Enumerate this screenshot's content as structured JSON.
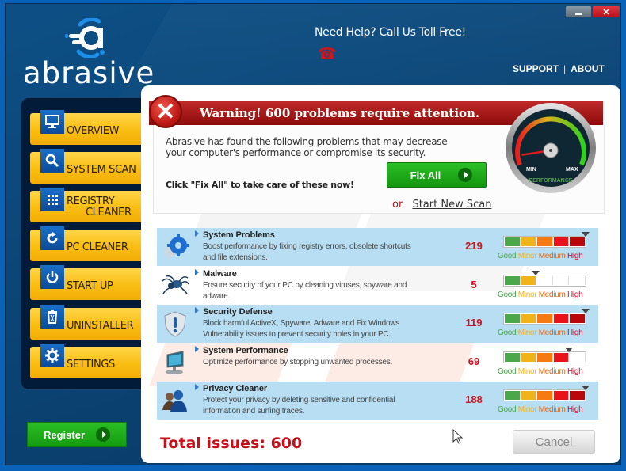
{
  "window": {
    "minimize_label": "_",
    "close_label": "✕"
  },
  "brand": {
    "name": "abrasive",
    "logo_icon": "abrasive-logo-icon"
  },
  "header": {
    "help_text": "Need Help? Call Us Toll Free!",
    "phone_icon": "☎",
    "links": [
      "SUPPORT",
      "ABOUT"
    ],
    "link_separator": "|"
  },
  "sidebar": {
    "items": [
      {
        "label": "OVERVIEW",
        "icon": "monitor-icon"
      },
      {
        "label": "SYSTEM SCAN",
        "icon": "magnifier-icon"
      },
      {
        "label": "REGISTRY",
        "label2": "CLEANER",
        "icon": "grid-icon"
      },
      {
        "label": "PC CLEANER",
        "icon": "refresh-icon"
      },
      {
        "label": "START UP",
        "icon": "power-icon"
      },
      {
        "label": "UNINSTALLER",
        "icon": "trash-icon"
      },
      {
        "label": "SETTINGS",
        "icon": "gear-icon"
      }
    ],
    "register_label": "Register"
  },
  "warning": {
    "title": "Warning! 600 problems require attention.",
    "description": "Abrasive has found the following problems that may decrease your computer's performance or compromise its security.",
    "cta_text": "Click \"Fix All\" to take care of these now!",
    "fix_all_label": "Fix All",
    "or_label": "or",
    "new_scan_label": "Start New Scan"
  },
  "gauge": {
    "min_label": "MIN",
    "max_label": "MAX",
    "caption": "PERFORMANCE",
    "level": 0.05
  },
  "severity_labels": {
    "good": "Good",
    "minor": "Minor",
    "medium": "Medium",
    "high": "High"
  },
  "severity_colors": [
    "#4aa84a",
    "#f0b41a",
    "#f57a12",
    "#e8141c",
    "#b8080e"
  ],
  "problems": [
    {
      "title": "System Problems",
      "description": "Boost performance by fixing registry errors, obsolete shortcuts and file extensions.",
      "count": "219",
      "severity_segments": 5,
      "icon": "gears-icon"
    },
    {
      "title": "Malware",
      "description": "Ensure security of your PC by cleaning viruses, spyware and adware.",
      "count": "5",
      "severity_segments": 2,
      "icon": "spider-icon"
    },
    {
      "title": "Security Defense",
      "description": "Block harmful ActiveX, Spyware, Adware and Fix Windows Vulnerability issues to prevent security holes in your PC.",
      "count": "119",
      "severity_segments": 5,
      "icon": "shield-icon"
    },
    {
      "title": "System Performance",
      "description": "Optimize performance by stopping unwanted processes.",
      "count": "69",
      "severity_segments": 4,
      "icon": "computer-icon"
    },
    {
      "title": "Privacy Cleaner",
      "description": "Protect your privacy by deleting sensitive and confidential information and surfing traces.",
      "count": "188",
      "severity_segments": 5,
      "icon": "users-icon"
    }
  ],
  "footer": {
    "total_label": "Total issues: 600",
    "cancel_label": "Cancel"
  }
}
